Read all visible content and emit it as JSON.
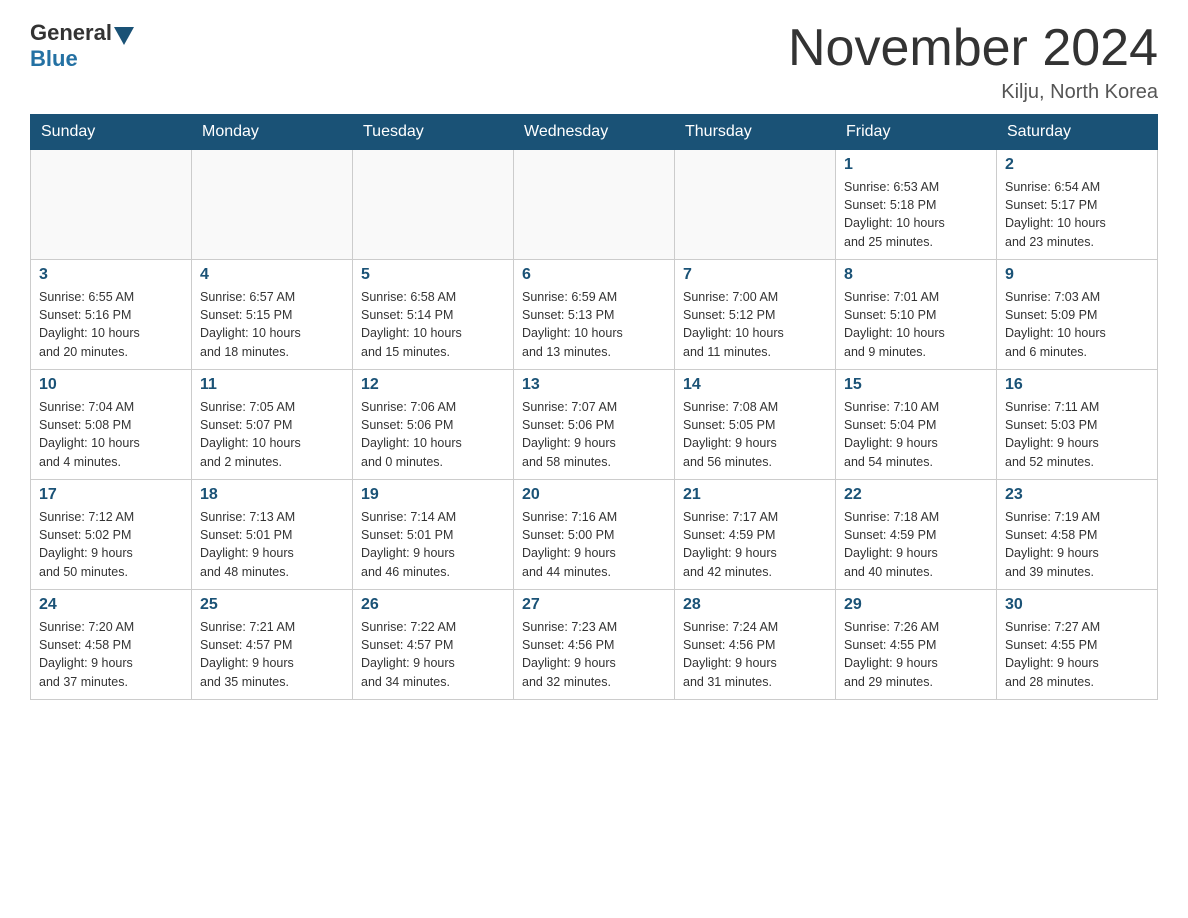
{
  "header": {
    "logo_general": "General",
    "logo_blue": "Blue",
    "month_title": "November 2024",
    "location": "Kilju, North Korea"
  },
  "weekdays": [
    "Sunday",
    "Monday",
    "Tuesday",
    "Wednesday",
    "Thursday",
    "Friday",
    "Saturday"
  ],
  "weeks": [
    [
      {
        "day": "",
        "info": ""
      },
      {
        "day": "",
        "info": ""
      },
      {
        "day": "",
        "info": ""
      },
      {
        "day": "",
        "info": ""
      },
      {
        "day": "",
        "info": ""
      },
      {
        "day": "1",
        "info": "Sunrise: 6:53 AM\nSunset: 5:18 PM\nDaylight: 10 hours\nand 25 minutes."
      },
      {
        "day": "2",
        "info": "Sunrise: 6:54 AM\nSunset: 5:17 PM\nDaylight: 10 hours\nand 23 minutes."
      }
    ],
    [
      {
        "day": "3",
        "info": "Sunrise: 6:55 AM\nSunset: 5:16 PM\nDaylight: 10 hours\nand 20 minutes."
      },
      {
        "day": "4",
        "info": "Sunrise: 6:57 AM\nSunset: 5:15 PM\nDaylight: 10 hours\nand 18 minutes."
      },
      {
        "day": "5",
        "info": "Sunrise: 6:58 AM\nSunset: 5:14 PM\nDaylight: 10 hours\nand 15 minutes."
      },
      {
        "day": "6",
        "info": "Sunrise: 6:59 AM\nSunset: 5:13 PM\nDaylight: 10 hours\nand 13 minutes."
      },
      {
        "day": "7",
        "info": "Sunrise: 7:00 AM\nSunset: 5:12 PM\nDaylight: 10 hours\nand 11 minutes."
      },
      {
        "day": "8",
        "info": "Sunrise: 7:01 AM\nSunset: 5:10 PM\nDaylight: 10 hours\nand 9 minutes."
      },
      {
        "day": "9",
        "info": "Sunrise: 7:03 AM\nSunset: 5:09 PM\nDaylight: 10 hours\nand 6 minutes."
      }
    ],
    [
      {
        "day": "10",
        "info": "Sunrise: 7:04 AM\nSunset: 5:08 PM\nDaylight: 10 hours\nand 4 minutes."
      },
      {
        "day": "11",
        "info": "Sunrise: 7:05 AM\nSunset: 5:07 PM\nDaylight: 10 hours\nand 2 minutes."
      },
      {
        "day": "12",
        "info": "Sunrise: 7:06 AM\nSunset: 5:06 PM\nDaylight: 10 hours\nand 0 minutes."
      },
      {
        "day": "13",
        "info": "Sunrise: 7:07 AM\nSunset: 5:06 PM\nDaylight: 9 hours\nand 58 minutes."
      },
      {
        "day": "14",
        "info": "Sunrise: 7:08 AM\nSunset: 5:05 PM\nDaylight: 9 hours\nand 56 minutes."
      },
      {
        "day": "15",
        "info": "Sunrise: 7:10 AM\nSunset: 5:04 PM\nDaylight: 9 hours\nand 54 minutes."
      },
      {
        "day": "16",
        "info": "Sunrise: 7:11 AM\nSunset: 5:03 PM\nDaylight: 9 hours\nand 52 minutes."
      }
    ],
    [
      {
        "day": "17",
        "info": "Sunrise: 7:12 AM\nSunset: 5:02 PM\nDaylight: 9 hours\nand 50 minutes."
      },
      {
        "day": "18",
        "info": "Sunrise: 7:13 AM\nSunset: 5:01 PM\nDaylight: 9 hours\nand 48 minutes."
      },
      {
        "day": "19",
        "info": "Sunrise: 7:14 AM\nSunset: 5:01 PM\nDaylight: 9 hours\nand 46 minutes."
      },
      {
        "day": "20",
        "info": "Sunrise: 7:16 AM\nSunset: 5:00 PM\nDaylight: 9 hours\nand 44 minutes."
      },
      {
        "day": "21",
        "info": "Sunrise: 7:17 AM\nSunset: 4:59 PM\nDaylight: 9 hours\nand 42 minutes."
      },
      {
        "day": "22",
        "info": "Sunrise: 7:18 AM\nSunset: 4:59 PM\nDaylight: 9 hours\nand 40 minutes."
      },
      {
        "day": "23",
        "info": "Sunrise: 7:19 AM\nSunset: 4:58 PM\nDaylight: 9 hours\nand 39 minutes."
      }
    ],
    [
      {
        "day": "24",
        "info": "Sunrise: 7:20 AM\nSunset: 4:58 PM\nDaylight: 9 hours\nand 37 minutes."
      },
      {
        "day": "25",
        "info": "Sunrise: 7:21 AM\nSunset: 4:57 PM\nDaylight: 9 hours\nand 35 minutes."
      },
      {
        "day": "26",
        "info": "Sunrise: 7:22 AM\nSunset: 4:57 PM\nDaylight: 9 hours\nand 34 minutes."
      },
      {
        "day": "27",
        "info": "Sunrise: 7:23 AM\nSunset: 4:56 PM\nDaylight: 9 hours\nand 32 minutes."
      },
      {
        "day": "28",
        "info": "Sunrise: 7:24 AM\nSunset: 4:56 PM\nDaylight: 9 hours\nand 31 minutes."
      },
      {
        "day": "29",
        "info": "Sunrise: 7:26 AM\nSunset: 4:55 PM\nDaylight: 9 hours\nand 29 minutes."
      },
      {
        "day": "30",
        "info": "Sunrise: 7:27 AM\nSunset: 4:55 PM\nDaylight: 9 hours\nand 28 minutes."
      }
    ]
  ]
}
